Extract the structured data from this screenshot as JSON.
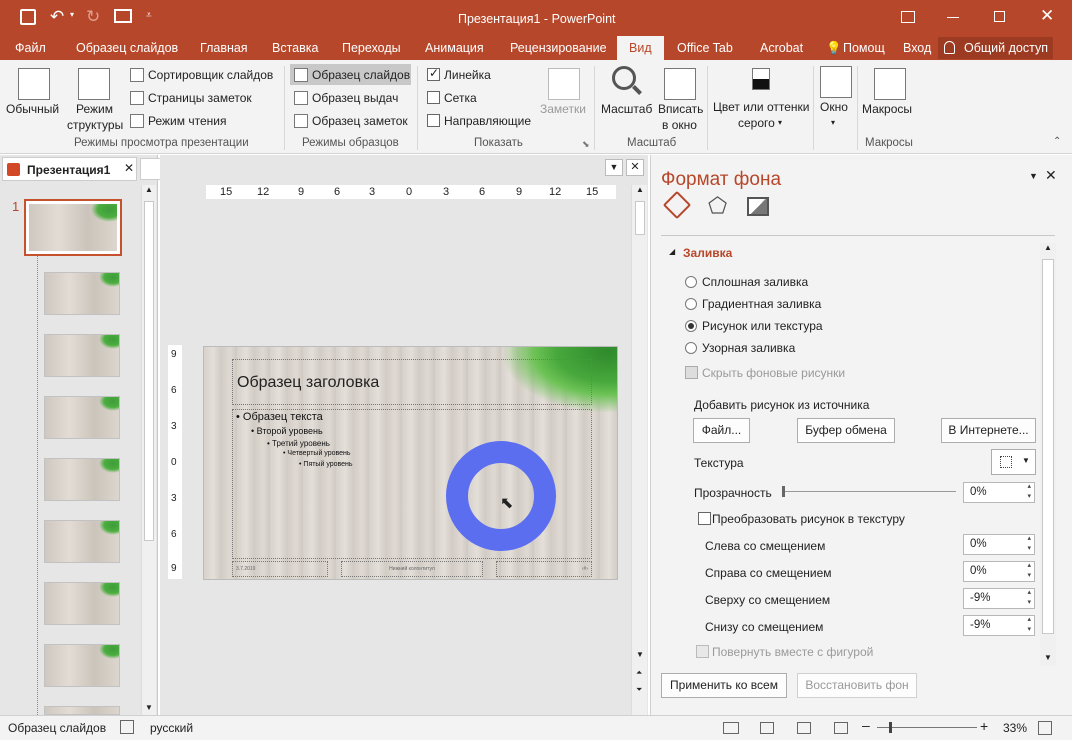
{
  "window": {
    "title": "Презентация1 - PowerPoint"
  },
  "colors": {
    "accent": "#b7472a",
    "ring": "#5b6ef0"
  },
  "tabs": [
    "Файл",
    "Образец слайдов",
    "Главная",
    "Вставка",
    "Переходы",
    "Анимация",
    "Рецензирование",
    "Вид",
    "Office Tab",
    "Acrobat",
    "Помощ",
    "Вход",
    "Общий доступ"
  ],
  "ribbon": {
    "views": {
      "normal": "Обычный",
      "outline1": "Режим",
      "outline2": "структуры",
      "sorter": "Сортировщик слайдов",
      "notes": "Страницы заметок",
      "reading": "Режим чтения",
      "label": "Режимы просмотра презентации"
    },
    "masters": {
      "slide": "Образец слайдов",
      "handout": "Образец выдач",
      "notes": "Образец заметок",
      "label": "Режимы образцов"
    },
    "show": {
      "ruler": "Линейка",
      "grid": "Сетка",
      "guides": "Направляющие",
      "notes": "Заметки",
      "label": "Показать"
    },
    "zoom": {
      "zoom": "Масштаб",
      "fit1": "Вписать",
      "fit2": "в окно",
      "label": "Масштаб"
    },
    "color": {
      "line1": "Цвет или оттенки",
      "line2": "серого"
    },
    "window": {
      "label": "Окно"
    },
    "macros": {
      "btn": "Макросы",
      "label": "Макросы"
    }
  },
  "doctab": "Презентация1",
  "slide_number": "1",
  "ruler_h": [
    "15",
    "12",
    "9",
    "6",
    "3",
    "0",
    "3",
    "6",
    "9",
    "12",
    "15"
  ],
  "ruler_v": [
    "9",
    "6",
    "3",
    "0",
    "3",
    "6",
    "9"
  ],
  "slide": {
    "title": "Образец заголовка",
    "level1": "Образец текста",
    "level2": "Второй уровень",
    "level3": "Третий уровень",
    "level4": "Четвертый уровень",
    "level5": "Пятый уровень",
    "date": "3.7.2019",
    "footer": "Нижний колонтитул",
    "num": "‹#›"
  },
  "panel": {
    "title": "Формат фона",
    "section": "Заливка",
    "fills": [
      "Сплошная заливка",
      "Градиентная заливка",
      "Рисунок или текстура",
      "Узорная заливка"
    ],
    "selected_fill": "Рисунок или текстура",
    "hide_bg": "Скрыть фоновые рисунки",
    "insert_from": "Добавить рисунок из источника",
    "btn_file": "Файл...",
    "btn_clipboard": "Буфер обмена",
    "btn_online": "В Интернете...",
    "texture": "Текстура",
    "transparency": "Прозрачность",
    "transparency_val": "0%",
    "tile": "Преобразовать рисунок в текстуру",
    "left": "Слева со смещением",
    "left_val": "0%",
    "right": "Справа со смещением",
    "right_val": "0%",
    "top": "Сверху со смещением",
    "top_val": "-9%",
    "bottom": "Снизу со смещением",
    "bottom_val": "-9%",
    "rotate": "Повернуть вместе с фигурой",
    "apply_all": "Применить ко всем",
    "reset": "Восстановить фон"
  },
  "status": {
    "mode": "Образец слайдов",
    "lang": "русский",
    "zoom": "33%"
  }
}
